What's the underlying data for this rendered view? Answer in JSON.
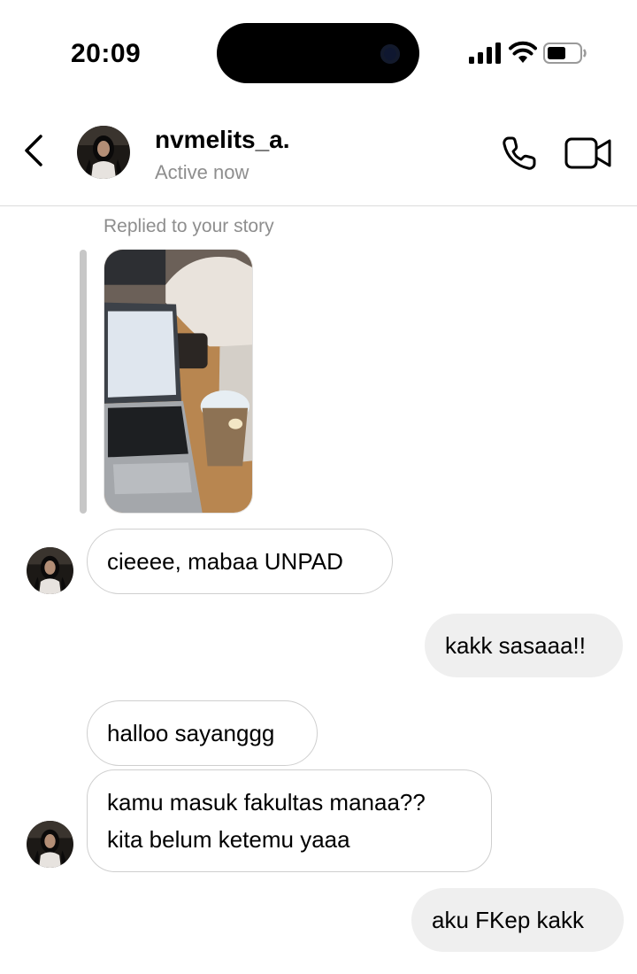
{
  "status_bar": {
    "time": "20:09",
    "icons": [
      "signal-icon",
      "wifi-icon",
      "battery-icon"
    ]
  },
  "header": {
    "username": "nvmelits_a.",
    "status": "Active now",
    "icons": [
      "back-chevron-icon",
      "phone-icon",
      "video-camera-icon"
    ]
  },
  "story_reply": {
    "label": "Replied to your story"
  },
  "messages": [
    {
      "from": "them",
      "lines": [
        "cieeee, mabaa UNPAD"
      ]
    },
    {
      "from": "me",
      "lines": [
        "kakk sasaaa!!"
      ]
    },
    {
      "from": "them",
      "lines": [
        "halloo sayanggg"
      ]
    },
    {
      "from": "them",
      "lines": [
        "kamu masuk fakultas manaa??",
        "kita belum ketemu yaaa"
      ]
    },
    {
      "from": "me",
      "lines": [
        "aku FKep kakk"
      ]
    }
  ],
  "colors": {
    "incoming_bubble_border": "#cfcfcf",
    "outgoing_bubble_bg": "#efefef",
    "secondary_text": "#8e8e8e"
  }
}
